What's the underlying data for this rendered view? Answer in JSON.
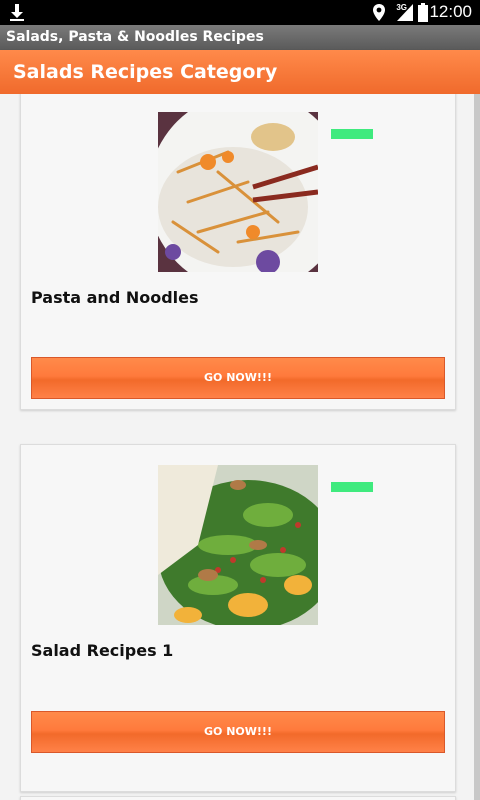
{
  "status_bar": {
    "time": "12:00",
    "network": "3G",
    "icons": [
      "download-icon",
      "location-icon",
      "signal-icon",
      "battery-icon"
    ]
  },
  "app_title": "Salads, Pasta & Noodles Recipes",
  "category_header": "Salads Recipes Category",
  "colors": {
    "accent": "#f47437",
    "badge": "#3fea7e",
    "title_bar": "#666666"
  },
  "cards": [
    {
      "title": "Pasta and Noodles",
      "button_label": "GO NOW!!!",
      "image": "noodle-salad-photo"
    },
    {
      "title": "Salad Recipes 1",
      "button_label": "GO NOW!!!",
      "image": "green-salad-photo"
    }
  ]
}
